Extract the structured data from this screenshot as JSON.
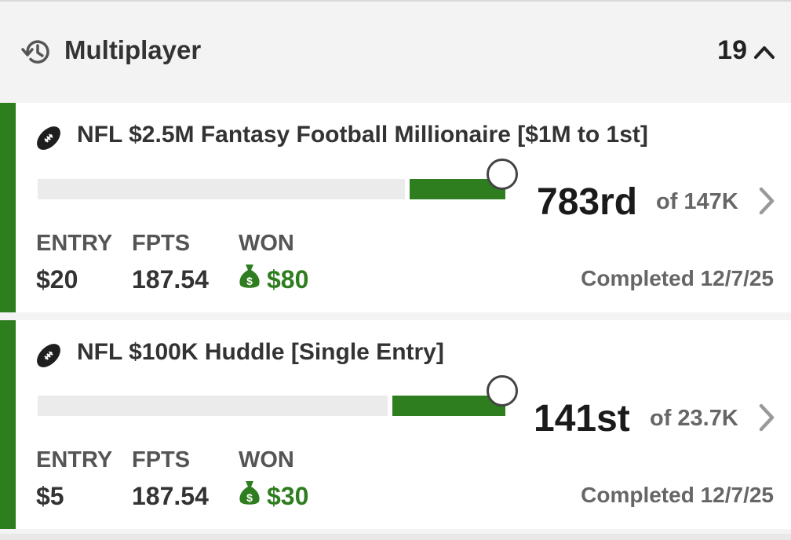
{
  "section": {
    "title": "Multiplayer",
    "count": "19",
    "icon": "history-icon",
    "toggle_icon": "chevron-up-icon"
  },
  "colors": {
    "accent": "#2e7d1f",
    "track": "#ebebeb",
    "background": "#f3f3f3"
  },
  "contests": [
    {
      "title": "NFL $2.5M Fantasy Football Millionaire [$1M to 1st]",
      "rank": "783rd",
      "field": "of 147K",
      "percentile_fill": 0.995,
      "labels": {
        "entry": "ENTRY",
        "fpts": "FPTS",
        "won": "WON"
      },
      "entry": "$20",
      "fpts": "187.54",
      "won": "$80",
      "status": "Completed 12/7/25"
    },
    {
      "title": "NFL $100K Huddle [Single Entry]",
      "rank": "141st",
      "field": "of 23.7K",
      "percentile_fill": 0.994,
      "labels": {
        "entry": "ENTRY",
        "fpts": "FPTS",
        "won": "WON"
      },
      "entry": "$5",
      "fpts": "187.54",
      "won": "$30",
      "status": "Completed 12/7/25"
    }
  ]
}
